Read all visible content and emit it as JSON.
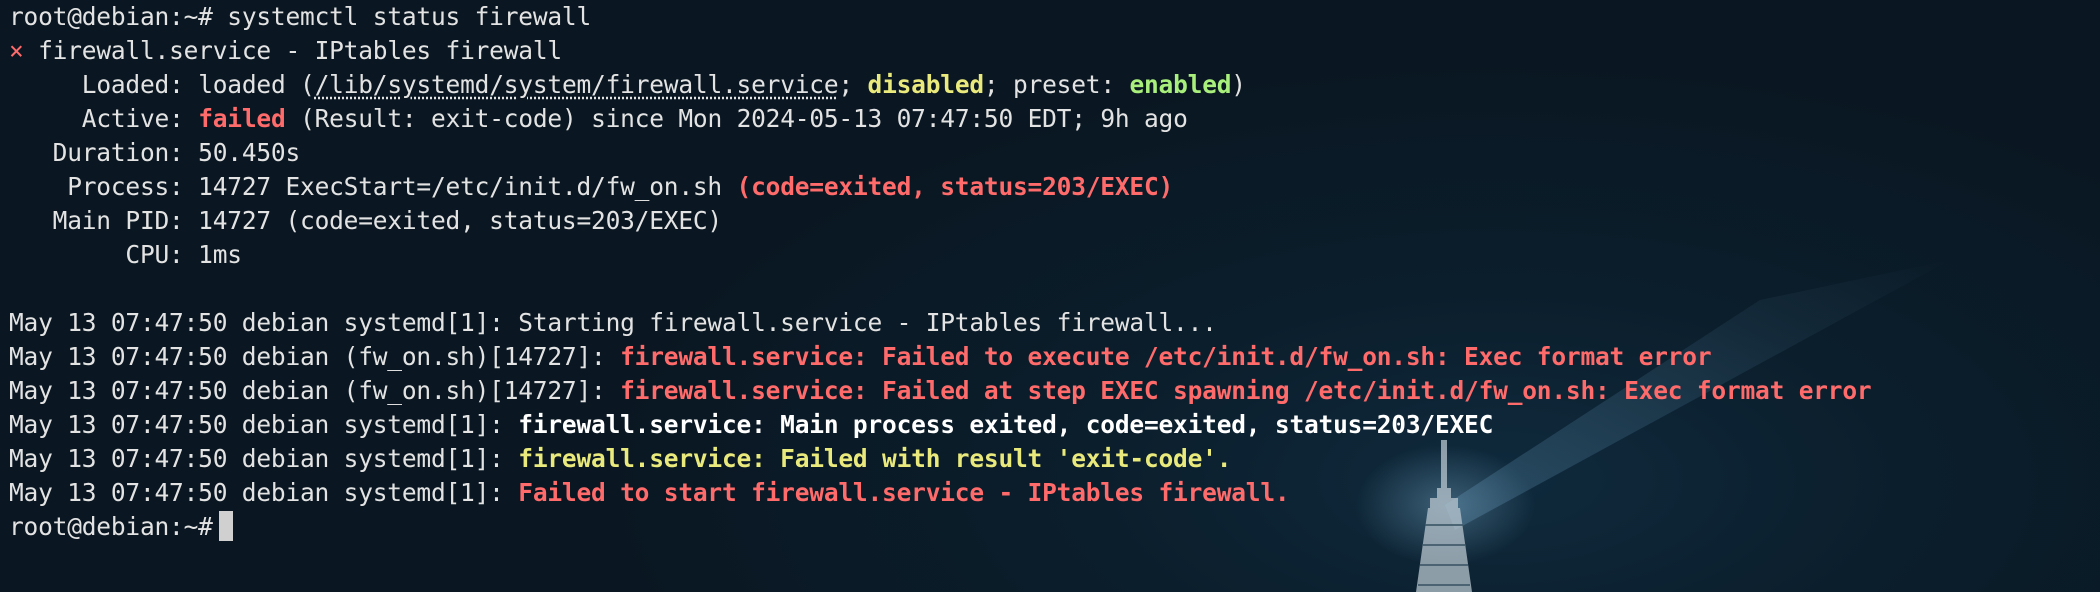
{
  "terminal": {
    "prompt": "root@debian:~#",
    "command": "systemctl status firewall",
    "status_mark": "×",
    "unit_header": "firewall.service - IPtables firewall",
    "loaded": {
      "key": "Loaded:",
      "value_prefix": "loaded (",
      "path": "/lib/systemd/system/firewall.service",
      "sep1": "; ",
      "state": "disabled",
      "sep2": "; preset: ",
      "preset": "enabled",
      "close": ")"
    },
    "active": {
      "key": "Active:",
      "state": "failed",
      "rest": "(Result: exit-code) since Mon 2024-05-13 07:47:50 EDT; 9h ago"
    },
    "duration": {
      "key": "Duration:",
      "value": "50.450s"
    },
    "process": {
      "key": "Process:",
      "value": "14727 ExecStart=/etc/init.d/fw_on.sh",
      "code": "(code=exited, status=203/EXEC)"
    },
    "main_pid": {
      "key": "Main PID:",
      "value": "14727 (code=exited, status=203/EXEC)"
    },
    "cpu": {
      "key": "CPU:",
      "value": "1ms"
    },
    "logs": [
      {
        "prefix": "May 13 07:47:50 debian systemd[1]:",
        "message": "Starting firewall.service - IPtables firewall..."
      },
      {
        "prefix": "May 13 07:47:50 debian (fw_on.sh)[14727]:",
        "message": "firewall.service: Failed to execute /etc/init.d/fw_on.sh: Exec format error"
      },
      {
        "prefix": "May 13 07:47:50 debian (fw_on.sh)[14727]:",
        "message": "firewall.service: Failed at step EXEC spawning /etc/init.d/fw_on.sh: Exec format error"
      },
      {
        "prefix": "May 13 07:47:50 debian systemd[1]:",
        "message": "firewall.service: Main process exited, code=exited, status=203/EXEC"
      },
      {
        "prefix": "May 13 07:47:50 debian systemd[1]:",
        "message": "firewall.service: Failed with result 'exit-code'."
      },
      {
        "prefix": "May 13 07:47:50 debian systemd[1]:",
        "message": "Failed to start firewall.service - IPtables firewall."
      }
    ],
    "final_prompt": "root@debian:~#"
  },
  "colors": {
    "background": "#0b1e2c",
    "text": "#e3e3e3",
    "error": "#ff6b6b",
    "warning": "#eaea7c",
    "ok": "#a8ef7c"
  }
}
